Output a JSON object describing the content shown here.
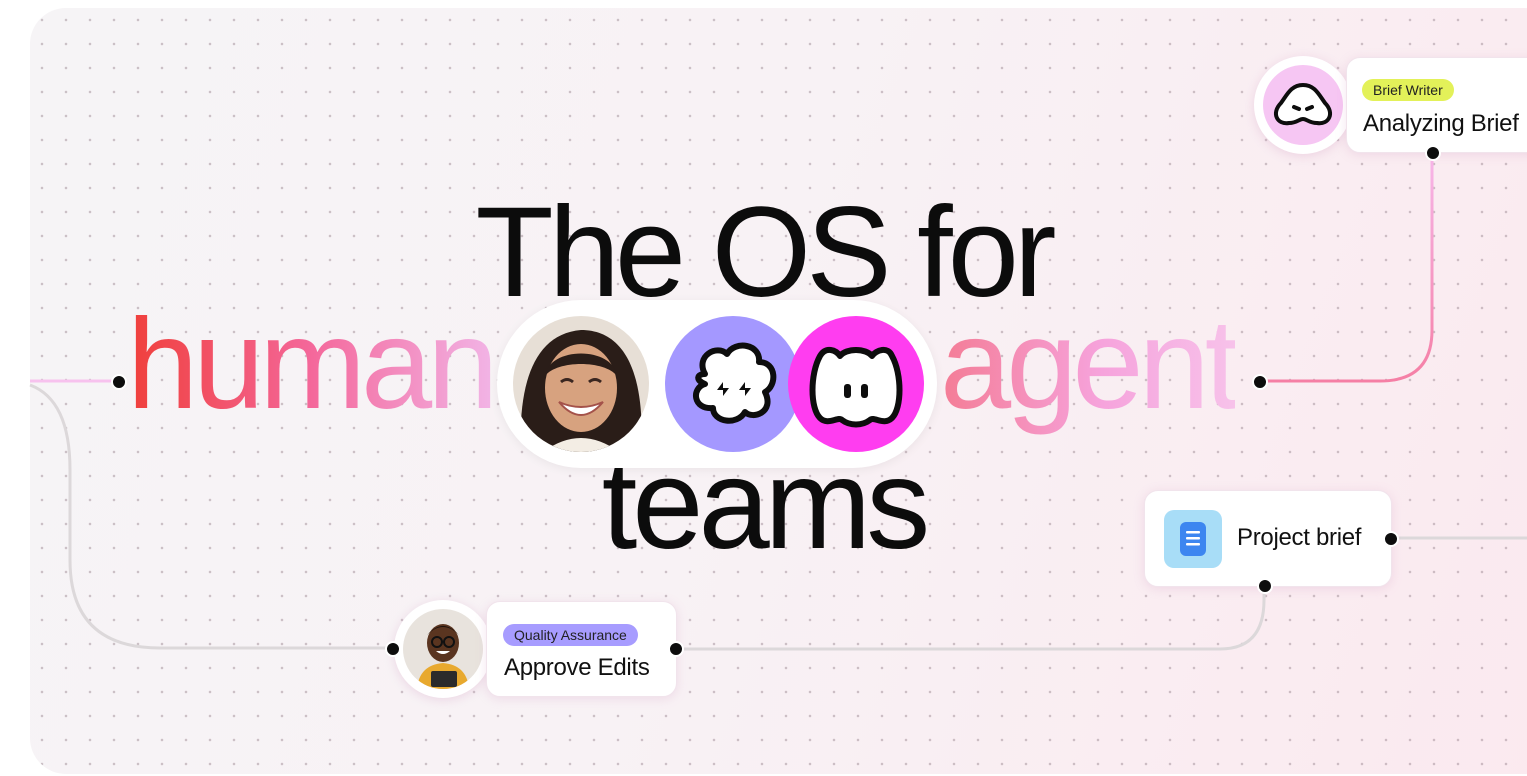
{
  "headline": {
    "line1": "The OS for",
    "word_left": "human",
    "word_right": "agent",
    "line3": "teams"
  },
  "nodes": {
    "brief_writer": {
      "tag": "Brief Writer",
      "title": "Analyzing Brief",
      "tag_color": "#e3f159",
      "icon": "agent-face-icon"
    },
    "project_brief": {
      "title": "Project brief",
      "icon": "document-icon",
      "icon_color": "#4a8ef2"
    },
    "quality_assurance": {
      "tag": "Quality Assurance",
      "title": "Approve Edits",
      "tag_color": "#a79cff",
      "icon": "person-avatar"
    }
  },
  "colors": {
    "agent_purple": "#a498ff",
    "agent_magenta": "#ff3df0",
    "agent_pink_light": "#f6c6f3",
    "wire_red": "#ef3c4a",
    "wire_gray": "#d9d6d8"
  }
}
